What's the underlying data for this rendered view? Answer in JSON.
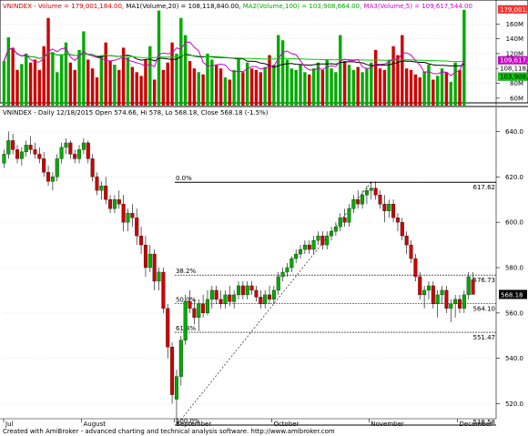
{
  "volume_panel": {
    "title_parts": [
      {
        "text": "VNINDEX - Volume = 179,001,184.00, ",
        "color": "#cc0000"
      },
      {
        "text": "MA1(Volume,20) = 108,118,840.00, ",
        "color": "#000000"
      },
      {
        "text": "MA2(Volume,100) = 103,908,664.00, ",
        "color": "#00aa00"
      },
      {
        "text": "MA3(Volume,5) = 109,617,544.00",
        "color": "#cc00cc"
      }
    ],
    "y_ticks": [
      "160M",
      "140M",
      "120M",
      "100M",
      "80M",
      "60M"
    ],
    "tags": [
      {
        "text": "179,001,1",
        "value": 179,
        "bg": "#ff3333",
        "fg": "#ffffff"
      },
      {
        "text": "109,617,5",
        "value": 110.5,
        "bg": "#cc00cc",
        "fg": "#ffffff"
      },
      {
        "text": "108,118,8",
        "value": 108,
        "bg": "#ffffff",
        "fg": "#000000"
      },
      {
        "text": "103,908,6",
        "value": 103.5,
        "bg": "#00cc00",
        "fg": "#000000"
      }
    ]
  },
  "price_panel": {
    "title": "VNINDEX - Daily 12/18/2015 Open 574.66, Hi 578, Lo 568.18, Close 568.18 (-1.5%)",
    "y_ticks": [
      "640.0",
      "620.0",
      "600.0",
      "580.0",
      "560.0",
      "540.0",
      "520.0"
    ],
    "last_price_tag": "568.18",
    "fib_levels": [
      {
        "pct": "0.0%",
        "value": "617.62",
        "price": 617.62
      },
      {
        "pct": "38.2%",
        "value": "576.73",
        "price": 576.73
      },
      {
        "pct": "50.0%",
        "value": "564.10",
        "price": 564.1
      },
      {
        "pct": "61.8%",
        "value": "551.47",
        "price": 551.47
      },
      {
        "pct": "100.0%",
        "value": "510.58",
        "price": 510.58
      }
    ]
  },
  "x_axis": {
    "months": [
      "Jul",
      "August",
      "September",
      "October",
      "November",
      "December"
    ]
  },
  "footer": {
    "credit": "Created with AmiBroker - advanced charting and technical analysis software. http://www.amibroker.com"
  },
  "colors": {
    "up": "#00aa00",
    "down": "#cc0000",
    "ma1": "#000000",
    "ma2": "#00cc00",
    "ma3": "#cc00cc"
  },
  "chart_data": {
    "type": "candlestick",
    "title": "VNINDEX - Daily 12/18/2015 Open 574.66, Hi 578, Lo 568.18, Close 568.18 (-1.5%)",
    "price_ylim": [
      515,
      645
    ],
    "volume_ylim": [
      50,
      180
    ],
    "ohlc": [
      [
        626,
        632,
        624,
        630
      ],
      [
        630,
        640,
        628,
        636
      ],
      [
        636,
        639,
        630,
        632
      ],
      [
        632,
        634,
        626,
        628
      ],
      [
        628,
        633,
        625,
        631
      ],
      [
        631,
        636,
        629,
        634
      ],
      [
        634,
        638,
        630,
        632
      ],
      [
        632,
        635,
        628,
        630
      ],
      [
        630,
        633,
        626,
        628
      ],
      [
        628,
        631,
        620,
        622
      ],
      [
        622,
        625,
        616,
        618
      ],
      [
        618,
        622,
        614,
        620
      ],
      [
        620,
        630,
        618,
        628
      ],
      [
        628,
        635,
        626,
        633
      ],
      [
        633,
        637,
        630,
        635
      ],
      [
        635,
        636,
        628,
        630
      ],
      [
        630,
        632,
        626,
        628
      ],
      [
        628,
        634,
        626,
        632
      ],
      [
        632,
        637,
        630,
        635
      ],
      [
        635,
        636,
        626,
        628
      ],
      [
        628,
        630,
        618,
        620
      ],
      [
        620,
        622,
        612,
        614
      ],
      [
        614,
        618,
        610,
        616
      ],
      [
        616,
        620,
        608,
        610
      ],
      [
        610,
        612,
        604,
        606
      ],
      [
        606,
        612,
        604,
        610
      ],
      [
        610,
        614,
        606,
        608
      ],
      [
        608,
        612,
        596,
        600
      ],
      [
        600,
        606,
        596,
        604
      ],
      [
        604,
        608,
        598,
        602
      ],
      [
        602,
        606,
        590,
        594
      ],
      [
        594,
        598,
        586,
        590
      ],
      [
        590,
        594,
        576,
        580
      ],
      [
        580,
        590,
        578,
        586
      ],
      [
        586,
        588,
        570,
        574
      ],
      [
        574,
        580,
        570,
        578
      ],
      [
        578,
        580,
        560,
        562
      ],
      [
        562,
        564,
        540,
        545
      ],
      [
        545,
        547,
        520,
        524
      ],
      [
        522,
        535,
        511,
        532
      ],
      [
        532,
        550,
        528,
        548
      ],
      [
        548,
        568,
        546,
        565
      ],
      [
        565,
        570,
        560,
        562
      ],
      [
        562,
        566,
        555,
        558
      ],
      [
        558,
        566,
        552,
        564
      ],
      [
        564,
        568,
        558,
        560
      ],
      [
        560,
        570,
        559,
        566
      ],
      [
        566,
        572,
        562,
        570
      ],
      [
        570,
        572,
        564,
        566
      ],
      [
        566,
        570,
        562,
        564
      ],
      [
        564,
        570,
        562,
        568
      ],
      [
        568,
        572,
        563,
        565
      ],
      [
        565,
        570,
        562,
        568
      ],
      [
        568,
        574,
        566,
        572
      ],
      [
        572,
        574,
        566,
        568
      ],
      [
        568,
        574,
        566,
        572
      ],
      [
        572,
        574,
        568,
        570
      ],
      [
        570,
        572,
        565,
        567
      ],
      [
        567,
        570,
        562,
        564
      ],
      [
        564,
        570,
        562,
        568
      ],
      [
        568,
        572,
        564,
        566
      ],
      [
        566,
        572,
        564,
        570
      ],
      [
        570,
        578,
        568,
        576
      ],
      [
        576,
        580,
        574,
        578
      ],
      [
        578,
        582,
        576,
        580
      ],
      [
        580,
        585,
        578,
        584
      ],
      [
        584,
        588,
        582,
        586
      ],
      [
        586,
        590,
        584,
        588
      ],
      [
        588,
        592,
        586,
        590
      ],
      [
        590,
        592,
        586,
        588
      ],
      [
        588,
        594,
        586,
        592
      ],
      [
        592,
        596,
        590,
        594
      ],
      [
        594,
        596,
        588,
        590
      ],
      [
        590,
        596,
        588,
        594
      ],
      [
        594,
        598,
        592,
        596
      ],
      [
        596,
        600,
        594,
        598
      ],
      [
        598,
        604,
        596,
        602
      ],
      [
        602,
        606,
        598,
        600
      ],
      [
        600,
        608,
        598,
        606
      ],
      [
        606,
        612,
        604,
        610
      ],
      [
        610,
        614,
        606,
        608
      ],
      [
        608,
        614,
        606,
        612
      ],
      [
        612,
        616,
        608,
        614
      ],
      [
        614,
        618,
        610,
        615
      ],
      [
        615,
        618,
        610,
        612
      ],
      [
        612,
        614,
        606,
        608
      ],
      [
        608,
        612,
        600,
        605
      ],
      [
        605,
        610,
        602,
        608
      ],
      [
        608,
        610,
        600,
        602
      ],
      [
        602,
        604,
        596,
        600
      ],
      [
        600,
        602,
        592,
        594
      ],
      [
        594,
        596,
        586,
        590
      ],
      [
        590,
        592,
        582,
        584
      ],
      [
        584,
        586,
        574,
        576
      ],
      [
        576,
        578,
        566,
        568
      ],
      [
        568,
        572,
        562,
        570
      ],
      [
        570,
        574,
        566,
        572
      ],
      [
        572,
        574,
        562,
        564
      ],
      [
        564,
        570,
        558,
        568
      ],
      [
        568,
        572,
        564,
        570
      ],
      [
        570,
        572,
        560,
        562
      ],
      [
        562,
        566,
        556,
        564
      ],
      [
        564,
        568,
        558,
        566
      ],
      [
        566,
        568,
        560,
        562
      ],
      [
        562,
        570,
        560,
        568
      ],
      [
        568,
        578,
        566,
        576
      ],
      [
        574.66,
        578,
        568.18,
        568.18
      ]
    ],
    "volume_millions": [
      110,
      142,
      128,
      98,
      106,
      120,
      108,
      112,
      98,
      130,
      168,
      122,
      95,
      118,
      135,
      108,
      98,
      125,
      150,
      112,
      100,
      88,
      118,
      135,
      110,
      105,
      98,
      128,
      115,
      102,
      95,
      90,
      112,
      130,
      85,
      178,
      98,
      108,
      135,
      120,
      168,
      145,
      110,
      100,
      95,
      92,
      120,
      112,
      105,
      100,
      88,
      85,
      98,
      112,
      95,
      108,
      100,
      98,
      95,
      102,
      118,
      105,
      145,
      138,
      112,
      100,
      98,
      105,
      95,
      92,
      100,
      108,
      98,
      112,
      100,
      95,
      145,
      110,
      105,
      98,
      102,
      95,
      100,
      108,
      125,
      100,
      98,
      112,
      130,
      118,
      145,
      100,
      98,
      92,
      88,
      96,
      105,
      85,
      90,
      100,
      95,
      82,
      108,
      98,
      179
    ]
  }
}
